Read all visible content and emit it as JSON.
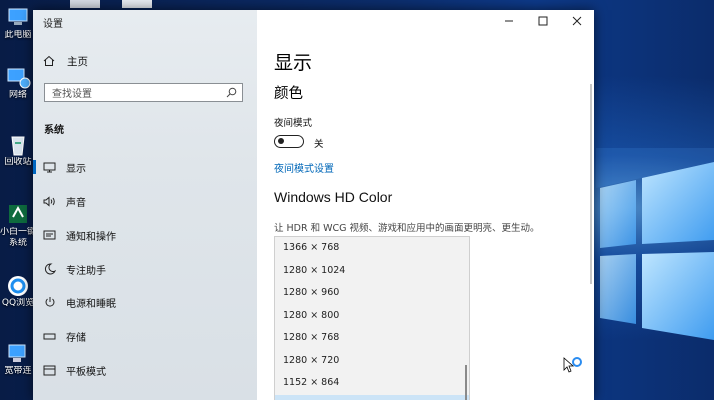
{
  "desktop": {
    "icons": [
      {
        "label": "此电脑",
        "icon": "computer-icon"
      },
      {
        "label": "网络",
        "icon": "network-icon"
      },
      {
        "label": "回收站",
        "icon": "recycle-bin-icon"
      },
      {
        "label": "小白一键",
        "icon": "xiaobai-app-icon"
      },
      {
        "label": "系统",
        "icon": ""
      },
      {
        "label": "QQ浏览",
        "icon": "qq-browser-icon"
      },
      {
        "label": "宽带连",
        "icon": "broadband-icon"
      }
    ]
  },
  "window": {
    "title": "设置",
    "controls": {
      "minimize": "minimize-icon",
      "maximize": "maximize-icon",
      "close": "close-icon"
    }
  },
  "sidebar": {
    "home": "主页",
    "search_placeholder": "查找设置",
    "section": "系统",
    "items": [
      {
        "label": "显示",
        "icon": "monitor-icon",
        "active": true
      },
      {
        "label": "声音",
        "icon": "speaker-icon"
      },
      {
        "label": "通知和操作",
        "icon": "notification-icon"
      },
      {
        "label": "专注助手",
        "icon": "moon-icon"
      },
      {
        "label": "电源和睡眠",
        "icon": "power-icon"
      },
      {
        "label": "存储",
        "icon": "storage-icon"
      },
      {
        "label": "平板模式",
        "icon": "tablet-icon"
      }
    ]
  },
  "main": {
    "title": "显示",
    "subtitle": "颜色",
    "night_light_label": "夜间模式",
    "night_light_state": "关",
    "night_light_settings_link": "夜间模式设置",
    "hd_color_heading": "Windows HD Color",
    "hd_color_desc": "让 HDR 和 WCG 视频、游戏和应用中的画面更明亮、更生动。",
    "resolution_options": [
      "1366 × 768",
      "1280 × 1024",
      "1280 × 960",
      "1280 × 800",
      "1280 × 768",
      "1280 × 720",
      "1152 × 864",
      ""
    ]
  },
  "colors": {
    "accent": "#0067c0",
    "link": "#0067b8"
  }
}
